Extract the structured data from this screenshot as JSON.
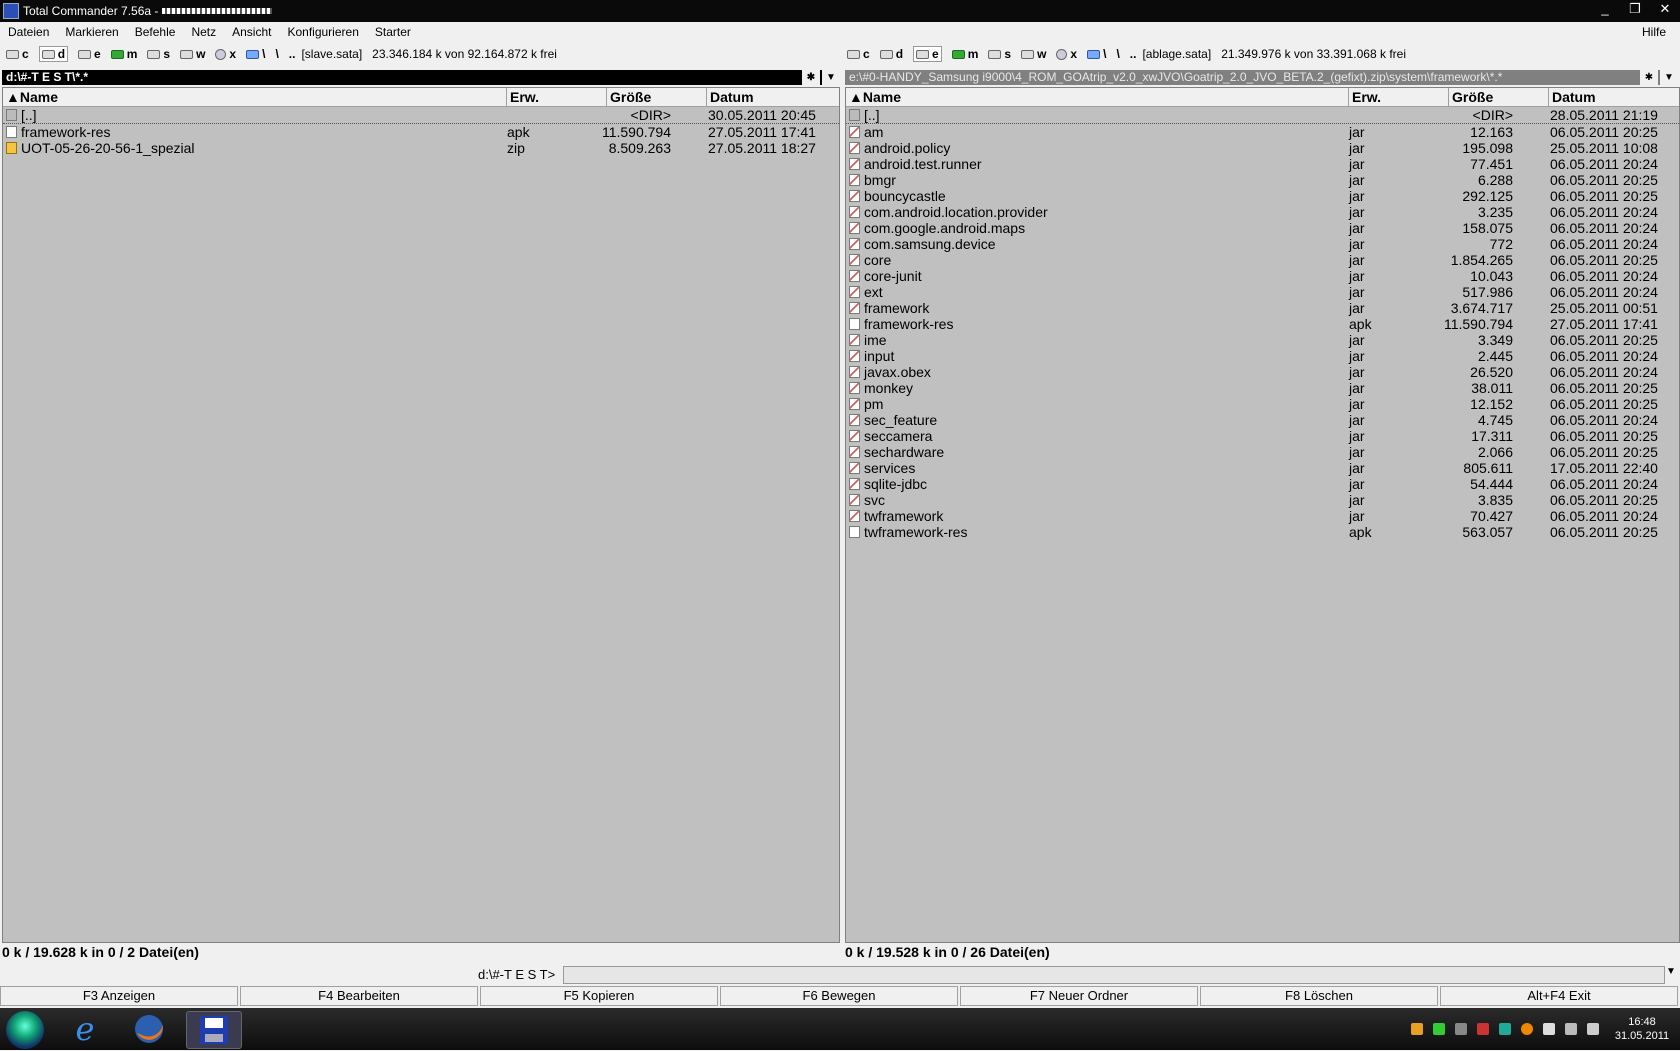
{
  "window": {
    "title": "Total Commander 7.56a -",
    "controls": [
      "_",
      "❐",
      "✕"
    ]
  },
  "menu": {
    "items": [
      "Dateien",
      "Markieren",
      "Befehle",
      "Netz",
      "Ansicht",
      "Konfigurieren",
      "Starter"
    ],
    "help": "Hilfe"
  },
  "left": {
    "drives": [
      "c",
      "d",
      "e",
      "m",
      "s",
      "w",
      "x",
      "\\",
      ".."
    ],
    "drive_selected": "d",
    "label": "[slave.sata]",
    "free": "23.346.184 k von 92.164.872 k frei",
    "path": "d:\\#-T E S T\\*.*",
    "headers": {
      "name": "Name",
      "ext": "Erw.",
      "size": "Größe",
      "date": "Datum"
    },
    "files": [
      {
        "name": "[..]",
        "ext": "",
        "size": "<DIR>",
        "date": "30.05.2011 20:45",
        "icon": "up"
      },
      {
        "name": "framework-res",
        "ext": "apk",
        "size": "11.590.794",
        "date": "27.05.2011 17:41",
        "icon": "file"
      },
      {
        "name": "UOT-05-26-20-56-1_spezial",
        "ext": "zip",
        "size": "8.509.263",
        "date": "27.05.2011 18:27",
        "icon": "zip"
      }
    ],
    "status": "0 k / 19.628 k in 0 / 2 Datei(en)"
  },
  "right": {
    "drives": [
      "c",
      "d",
      "e",
      "m",
      "s",
      "w",
      "x",
      "\\",
      ".."
    ],
    "drive_selected": "e",
    "label": "[ablage.sata]",
    "free": "21.349.976 k von 33.391.068 k frei",
    "path": "e:\\#0-HANDY_Samsung i9000\\4_ROM_GOAtrip_v2.0_xwJVO\\Goatrip_2.0_JVO_BETA.2_(gefixt).zip\\system\\framework\\*.*",
    "headers": {
      "name": "Name",
      "ext": "Erw.",
      "size": "Größe",
      "date": "Datum"
    },
    "files": [
      {
        "name": "[..]",
        "ext": "",
        "size": "<DIR>",
        "date": "28.05.2011 21:19",
        "icon": "up"
      },
      {
        "name": "am",
        "ext": "jar",
        "size": "12.163",
        "date": "06.05.2011 20:25",
        "icon": "jar"
      },
      {
        "name": "android.policy",
        "ext": "jar",
        "size": "195.098",
        "date": "25.05.2011 10:08",
        "icon": "jar"
      },
      {
        "name": "android.test.runner",
        "ext": "jar",
        "size": "77.451",
        "date": "06.05.2011 20:24",
        "icon": "jar"
      },
      {
        "name": "bmgr",
        "ext": "jar",
        "size": "6.288",
        "date": "06.05.2011 20:25",
        "icon": "jar"
      },
      {
        "name": "bouncycastle",
        "ext": "jar",
        "size": "292.125",
        "date": "06.05.2011 20:25",
        "icon": "jar"
      },
      {
        "name": "com.android.location.provider",
        "ext": "jar",
        "size": "3.235",
        "date": "06.05.2011 20:24",
        "icon": "jar"
      },
      {
        "name": "com.google.android.maps",
        "ext": "jar",
        "size": "158.075",
        "date": "06.05.2011 20:24",
        "icon": "jar"
      },
      {
        "name": "com.samsung.device",
        "ext": "jar",
        "size": "772",
        "date": "06.05.2011 20:24",
        "icon": "jar"
      },
      {
        "name": "core",
        "ext": "jar",
        "size": "1.854.265",
        "date": "06.05.2011 20:25",
        "icon": "jar"
      },
      {
        "name": "core-junit",
        "ext": "jar",
        "size": "10.043",
        "date": "06.05.2011 20:24",
        "icon": "jar"
      },
      {
        "name": "ext",
        "ext": "jar",
        "size": "517.986",
        "date": "06.05.2011 20:24",
        "icon": "jar"
      },
      {
        "name": "framework",
        "ext": "jar",
        "size": "3.674.717",
        "date": "25.05.2011 00:51",
        "icon": "jar"
      },
      {
        "name": "framework-res",
        "ext": "apk",
        "size": "11.590.794",
        "date": "27.05.2011 17:41",
        "icon": "file"
      },
      {
        "name": "ime",
        "ext": "jar",
        "size": "3.349",
        "date": "06.05.2011 20:25",
        "icon": "jar"
      },
      {
        "name": "input",
        "ext": "jar",
        "size": "2.445",
        "date": "06.05.2011 20:24",
        "icon": "jar"
      },
      {
        "name": "javax.obex",
        "ext": "jar",
        "size": "26.520",
        "date": "06.05.2011 20:24",
        "icon": "jar"
      },
      {
        "name": "monkey",
        "ext": "jar",
        "size": "38.011",
        "date": "06.05.2011 20:25",
        "icon": "jar"
      },
      {
        "name": "pm",
        "ext": "jar",
        "size": "12.152",
        "date": "06.05.2011 20:25",
        "icon": "jar"
      },
      {
        "name": "sec_feature",
        "ext": "jar",
        "size": "4.745",
        "date": "06.05.2011 20:24",
        "icon": "jar"
      },
      {
        "name": "seccamera",
        "ext": "jar",
        "size": "17.311",
        "date": "06.05.2011 20:25",
        "icon": "jar"
      },
      {
        "name": "sechardware",
        "ext": "jar",
        "size": "2.066",
        "date": "06.05.2011 20:25",
        "icon": "jar"
      },
      {
        "name": "services",
        "ext": "jar",
        "size": "805.611",
        "date": "17.05.2011 22:40",
        "icon": "jar"
      },
      {
        "name": "sqlite-jdbc",
        "ext": "jar",
        "size": "54.444",
        "date": "06.05.2011 20:24",
        "icon": "jar"
      },
      {
        "name": "svc",
        "ext": "jar",
        "size": "3.835",
        "date": "06.05.2011 20:25",
        "icon": "jar"
      },
      {
        "name": "twframework",
        "ext": "jar",
        "size": "70.427",
        "date": "06.05.2011 20:24",
        "icon": "jar"
      },
      {
        "name": "twframework-res",
        "ext": "apk",
        "size": "563.057",
        "date": "06.05.2011 20:25",
        "icon": "file"
      }
    ],
    "status": "0 k / 19.528 k in 0 / 26 Datei(en)"
  },
  "cmd": {
    "prompt": "d:\\#-T E S T>"
  },
  "fkeys": [
    "F3 Anzeigen",
    "F4 Bearbeiten",
    "F5 Kopieren",
    "F6 Bewegen",
    "F7 Neuer Ordner",
    "F8 Löschen",
    "Alt+F4 Exit"
  ],
  "taskbar": {
    "time": "16:48",
    "date": "31.05.2011"
  }
}
